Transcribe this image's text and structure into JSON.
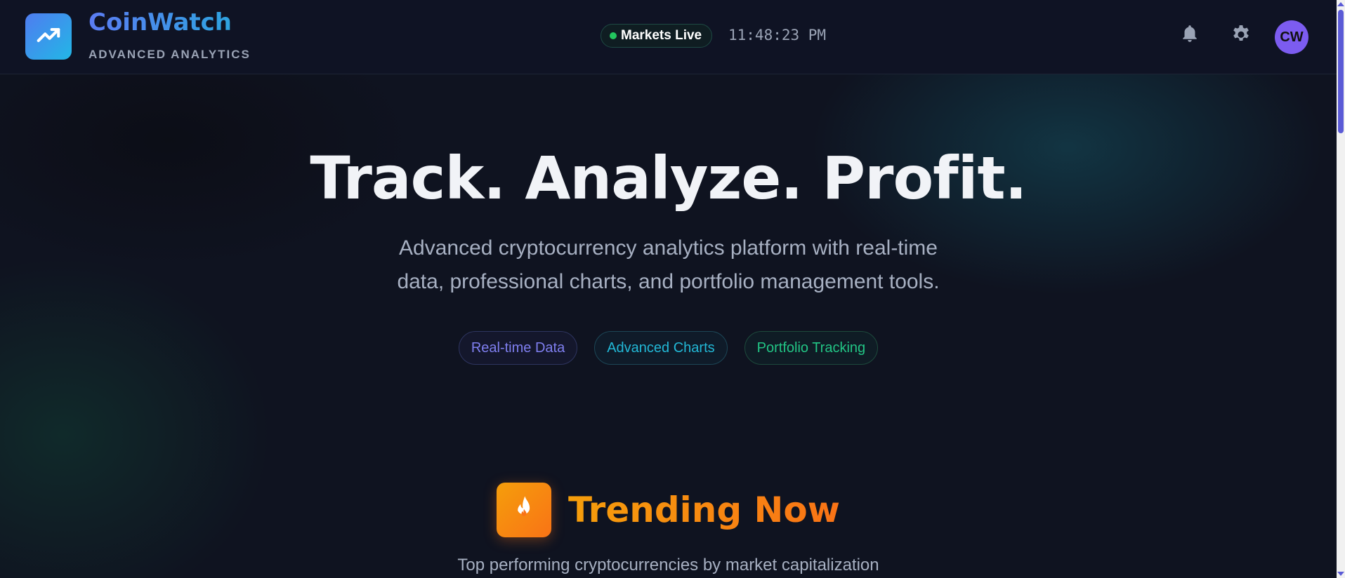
{
  "header": {
    "brand_title": "CoinWatch",
    "brand_subtitle": "ADVANCED ANALYTICS",
    "market_status": "Markets Live",
    "clock": "11:48:23 PM",
    "avatar_initials": "CW",
    "icons": [
      "trending-up-icon",
      "bell-icon",
      "gear-icon"
    ]
  },
  "hero": {
    "title": "Track. Analyze. Profit.",
    "subtitle_line1": "Advanced cryptocurrency analytics platform with real-time",
    "subtitle_line2": "data, professional charts, and portfolio management tools.",
    "chips": [
      "Real-time Data",
      "Advanced Charts",
      "Portfolio Tracking"
    ]
  },
  "trending": {
    "title": "Trending Now",
    "subtitle": "Top performing cryptocurrencies by market capitalization",
    "icon": "flame-icon"
  },
  "colors": {
    "background": "#0f1320",
    "brand_gradient_start": "#5b7cf3",
    "brand_gradient_end": "#2ea3e0",
    "live_dot": "#22c55e",
    "avatar": "#7c5cf0",
    "trending_accent": "#f97316"
  }
}
